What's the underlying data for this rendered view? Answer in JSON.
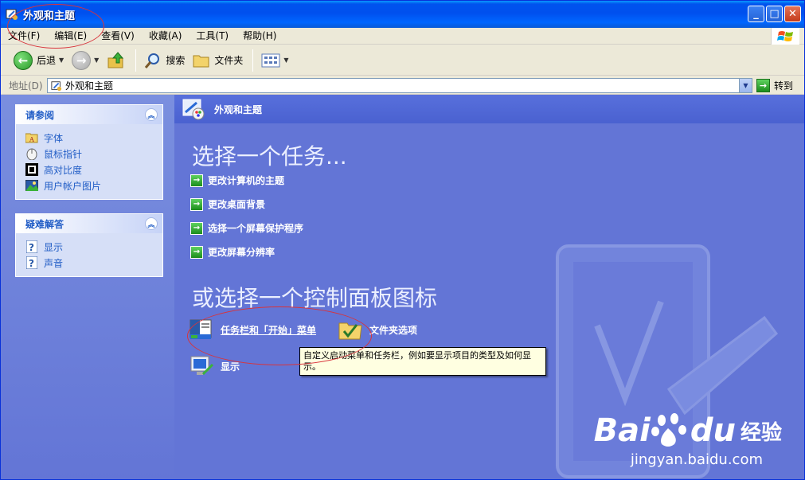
{
  "window": {
    "title": "外观和主题",
    "min_label": "_",
    "max_label": "□",
    "close_label": "✕"
  },
  "menu": [
    "文件(F)",
    "编辑(E)",
    "查看(V)",
    "收藏(A)",
    "工具(T)",
    "帮助(H)"
  ],
  "toolbar": {
    "back_label": "后退",
    "search_label": "搜索",
    "folders_label": "文件夹"
  },
  "address": {
    "label": "地址(D)",
    "value": "外观和主题",
    "go_label": "转到"
  },
  "see_also": {
    "title": "请参阅",
    "items": [
      {
        "label": "字体",
        "icon": "font-folder-icon"
      },
      {
        "label": "鼠标指针",
        "icon": "mouse-icon"
      },
      {
        "label": "高对比度",
        "icon": "contrast-icon"
      },
      {
        "label": "用户帐户图片",
        "icon": "picture-icon"
      }
    ]
  },
  "troubleshoot": {
    "title": "疑难解答",
    "items": [
      {
        "label": "显示",
        "icon": "help-icon"
      },
      {
        "label": "声音",
        "icon": "help-icon"
      }
    ]
  },
  "main": {
    "header_title": "外观和主题",
    "pick_task": "选择一个任务...",
    "tasks": [
      "更改计算机的主题",
      "更改桌面背景",
      "选择一个屏幕保护程序",
      "更改屏幕分辨率"
    ],
    "pick_icon": "或选择一个控制面板图标",
    "icons": [
      {
        "label": "任务栏和「开始」菜单",
        "icon": "taskbar-icon"
      },
      {
        "label": "文件夹选项",
        "icon": "folder-options-icon"
      },
      {
        "label": "显示",
        "icon": "display-icon"
      }
    ],
    "tooltip": "自定义启动菜单和任务栏，例如要显示项目的类型及如何显示。"
  },
  "watermark": {
    "brand_left": "Bai",
    "brand_right": "du",
    "brand_cn": "经验",
    "url": "jingyan.baidu.com"
  },
  "colors": {
    "accent": "#215dc6",
    "main_bg": "#6375d6",
    "annotation": "#d8343c"
  }
}
